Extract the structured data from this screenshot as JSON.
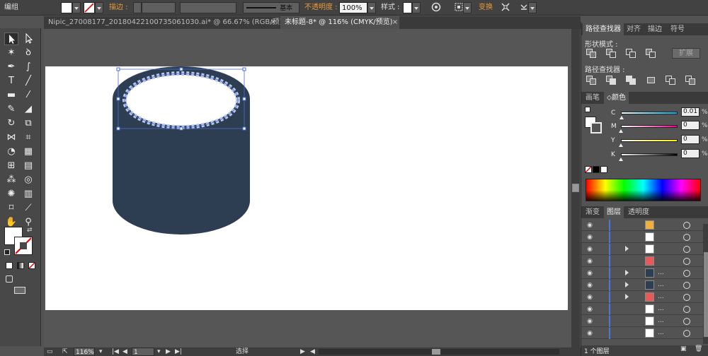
{
  "control_bar": {
    "selection_type": "编组",
    "stroke_label": "描边 :",
    "stroke_profile": "基本",
    "opacity_label": "不透明度 :",
    "opacity_value": "100%",
    "style_label": "样式 :",
    "transform_label": "变换"
  },
  "tabs": [
    {
      "label": "Nipic_27008177_20180422100735061030.ai* @ 66.67% (RGB/预览)",
      "close": "×"
    },
    {
      "label": "未标题-8* @ 116% (CMYK/预览)",
      "close": "×"
    }
  ],
  "pathfinder": {
    "tabs": [
      "路径查找器",
      "对齐",
      "描边",
      "符号"
    ],
    "shape_modes_label": "形状模式 :",
    "expand_label": "扩展",
    "pathfinders_label": "路径查找器 :"
  },
  "color": {
    "tabs": [
      "画笔",
      "颜色"
    ],
    "channels": [
      {
        "label": "C",
        "value": "0.01",
        "unit": "%",
        "level": 0.01,
        "gradient": "linear-gradient(to right,#ffffff,#00aeef)"
      },
      {
        "label": "M",
        "value": "0",
        "unit": "%",
        "level": 0,
        "gradient": "linear-gradient(to right,#ffffff,#ec008c)"
      },
      {
        "label": "Y",
        "value": "0",
        "unit": "%",
        "level": 0,
        "gradient": "linear-gradient(to right,#ffffff,#fff200)"
      },
      {
        "label": "K",
        "value": "0",
        "unit": "%",
        "level": 0,
        "gradient": "linear-gradient(to right,#ffffff,#000000)"
      }
    ]
  },
  "layers": {
    "tabs": [
      "渐变",
      "图层",
      "透明度"
    ],
    "rows": [
      {
        "thumb_color": "#f0b040",
        "expand": false,
        "dots": ""
      },
      {
        "thumb_color": "#ffffff",
        "expand": false,
        "dots": ""
      },
      {
        "thumb_color": "#ffffff",
        "expand": true,
        "dots": ""
      },
      {
        "thumb_color": "#e85a5a",
        "expand": false,
        "dots": ""
      },
      {
        "thumb_color": "#2e3e52",
        "expand": true,
        "dots": "..."
      },
      {
        "thumb_color": "#2e3e52",
        "expand": true,
        "dots": "..."
      },
      {
        "thumb_color": "#e85a5a",
        "expand": true,
        "dots": "..."
      },
      {
        "thumb_color": "#ffffff",
        "expand": false,
        "dots": "..."
      },
      {
        "thumb_color": "#ffffff",
        "expand": false,
        "dots": "..."
      },
      {
        "thumb_color": "#ffffff",
        "expand": false,
        "dots": "..."
      }
    ],
    "count_label": "1 个图层"
  },
  "status_bar": {
    "zoom": "116%",
    "page": "1",
    "mode": "选择"
  },
  "colors": {
    "cup_body": "#2e3e52",
    "selection": "#4a6fd8",
    "layer_bar": "#4a78d8",
    "orange_label": "#e99a3a"
  }
}
